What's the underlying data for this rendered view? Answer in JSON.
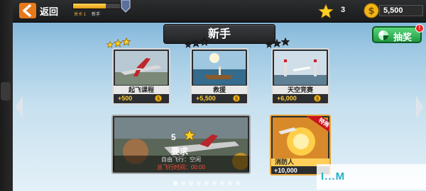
{
  "topbar": {
    "back_label": "返回",
    "level_label": "关卡 1",
    "next_label": "新手",
    "level_progress": 0.7,
    "stars": "3",
    "cash": "5,500"
  },
  "header": {
    "title": "新手"
  },
  "lottery": {
    "label": "抽奖",
    "badge": "!"
  },
  "missions": [
    {
      "name": "起飞课程",
      "reward": "+500",
      "stars": 3,
      "stars_earned": true
    },
    {
      "name": "救援",
      "reward": "+5,500",
      "stars": 3,
      "stars_earned": false
    },
    {
      "name": "天空竞赛",
      "reward": "+6,000",
      "stars": 3,
      "stars_earned": false
    }
  ],
  "locked_mission": {
    "required_stars": "5",
    "requirement_label": "要求",
    "mode_line": "自由飞行：空闲",
    "time_line": "总飞行时间：00:00"
  },
  "special_mission": {
    "ribbon": "特殊",
    "name": "消防人",
    "reward": "+10,000"
  },
  "pager": {
    "pages": 9,
    "active": 0
  },
  "watermark": {
    "text": "I...M"
  },
  "colors": {
    "accent": "#ffcc3a",
    "lottery_green": "#2fb552",
    "ribbon_red": "#c8161b",
    "time_red": "#ff4a3a"
  }
}
